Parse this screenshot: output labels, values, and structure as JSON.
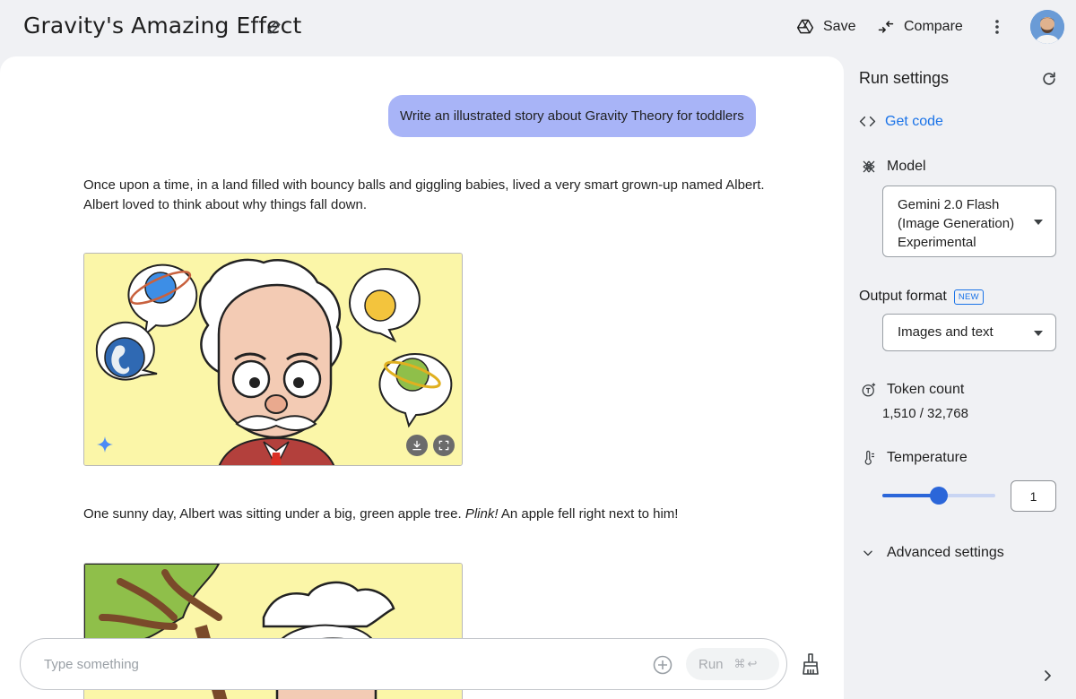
{
  "header": {
    "title": "Gravity's Amazing Effect",
    "save_label": "Save",
    "compare_label": "Compare"
  },
  "chat": {
    "user_message": "Write an illustrated story about Gravity Theory for toddlers",
    "paragraph_1": "Once upon a time, in a land filled with bouncy balls and giggling babies, lived a very smart grown-up named Albert. Albert loved to think about why things fall down.",
    "paragraph_2_before": "One sunny day, Albert was sitting under a big, green apple tree. ",
    "paragraph_2_em": "Plink!",
    "paragraph_2_after": " An apple fell right next to him!"
  },
  "input": {
    "placeholder": "Type something",
    "run_label": "Run",
    "run_shortcut": "⌘↩"
  },
  "settings": {
    "title": "Run settings",
    "get_code_label": "Get code",
    "model_label": "Model",
    "model_value_line1": "Gemini 2.0 Flash",
    "model_value_line2": "(Image Generation)",
    "model_value_line3": "Experimental",
    "output_format_label": "Output format",
    "output_format_badge": "NEW",
    "output_format_value": "Images and text",
    "token_count_label": "Token count",
    "token_count_value": "1,510 / 32,768",
    "temperature_label": "Temperature",
    "temperature_value": "1",
    "temperature_fraction": 0.5,
    "advanced_label": "Advanced settings"
  },
  "colors": {
    "accent": "#1a73e8",
    "user_bubble": "#a8b4f7",
    "slider": "#2b66d9",
    "illustration_bg": "#fbf6a8"
  },
  "icons": [
    "edit-icon",
    "drive-icon",
    "compare-icon",
    "more-vert-icon",
    "refresh-icon",
    "code-icon",
    "model-icon",
    "token-icon",
    "thermometer-icon",
    "chevron-down-icon",
    "add-circle-icon",
    "broom-icon",
    "chevron-right-icon",
    "download-icon",
    "fullscreen-icon",
    "sparkle-icon"
  ]
}
